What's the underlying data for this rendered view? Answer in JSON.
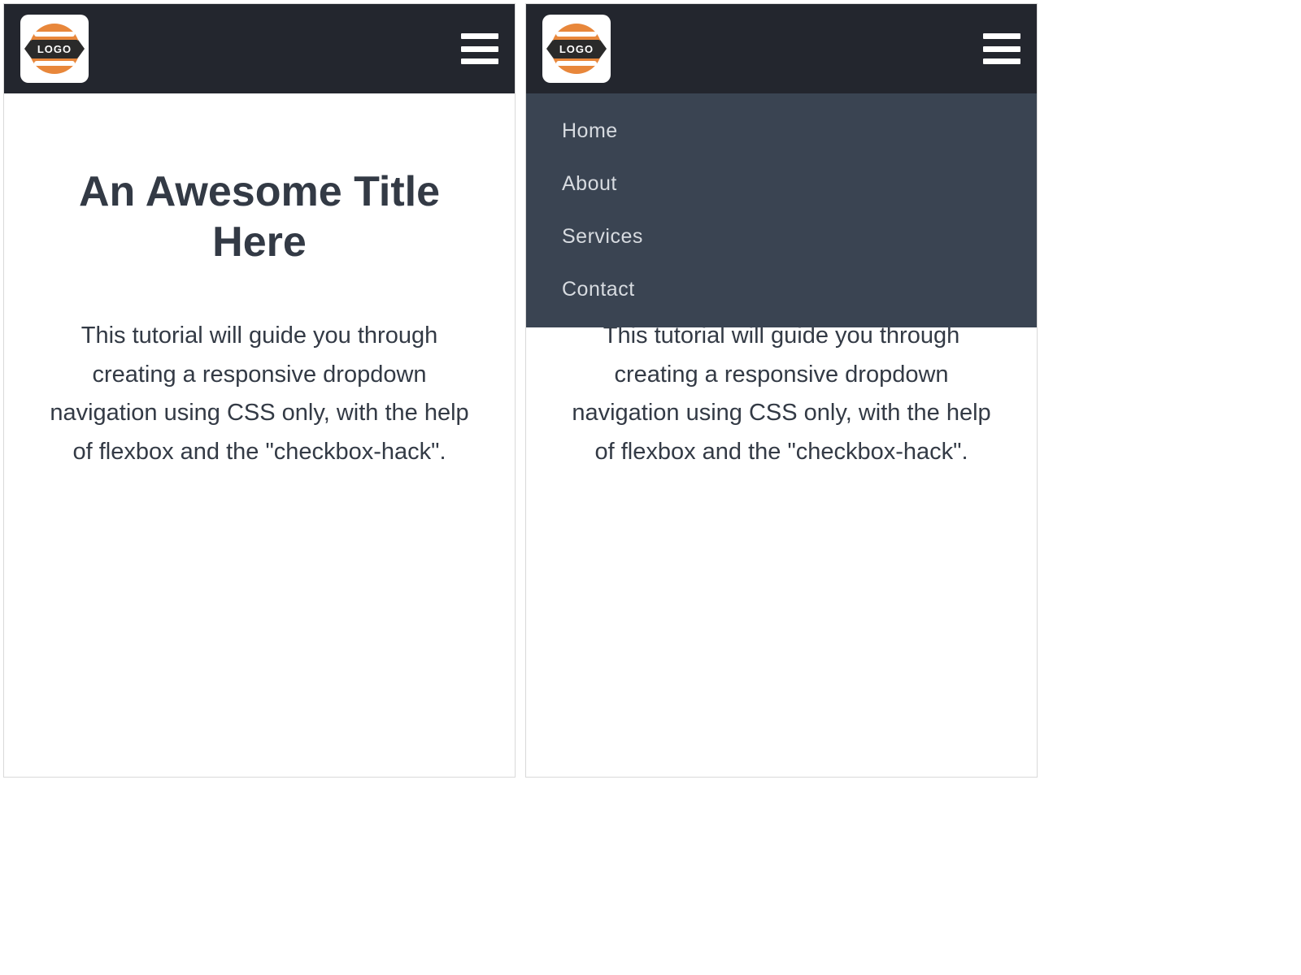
{
  "logo": {
    "text": "LOGO"
  },
  "menu": {
    "items": [
      "Home",
      "About",
      "Services",
      "Contact"
    ]
  },
  "article": {
    "title": "An Awesome Title Here",
    "body": "This tutorial will guide you through creating a responsive dropdown navigation using CSS only, with the help of flexbox and the \"checkbox-hack\"."
  }
}
